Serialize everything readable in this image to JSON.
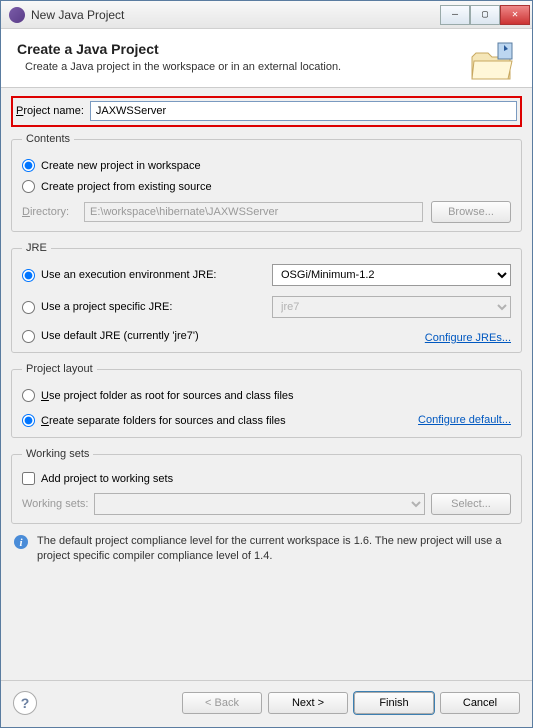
{
  "window": {
    "title": "New Java Project"
  },
  "win_controls": {
    "min": "—",
    "max": "▢",
    "close": "✕"
  },
  "header": {
    "title": "Create a Java Project",
    "subtitle": "Create a Java project in the workspace or in an external location."
  },
  "project_name": {
    "label": "Project name:",
    "value": "JAXWSServer"
  },
  "contents": {
    "legend": "Contents",
    "opt_new": "Create new project in workspace",
    "opt_existing": "Create project from existing source",
    "dir_label": "Directory:",
    "dir_value": "E:\\workspace\\hibernate\\JAXWSServer",
    "browse": "Browse..."
  },
  "jre": {
    "legend": "JRE",
    "opt_env": "Use an execution environment JRE:",
    "env_value": "OSGi/Minimum-1.2",
    "opt_specific": "Use a project specific JRE:",
    "specific_value": "jre7",
    "opt_default": "Use default JRE (currently 'jre7')",
    "configure": "Configure JREs..."
  },
  "layout": {
    "legend": "Project layout",
    "opt_root": "Use project folder as root for sources and class files",
    "opt_separate": "Create separate folders for sources and class files",
    "configure": "Configure default..."
  },
  "working_sets": {
    "legend": "Working sets",
    "add_label": "Add project to working sets",
    "ws_label": "Working sets:",
    "select": "Select..."
  },
  "info": {
    "text": "The default project compliance level for the current workspace is 1.6. The new project will use a project specific compiler compliance level of 1.4."
  },
  "buttons": {
    "back": "< Back",
    "next": "Next >",
    "finish": "Finish",
    "cancel": "Cancel"
  }
}
